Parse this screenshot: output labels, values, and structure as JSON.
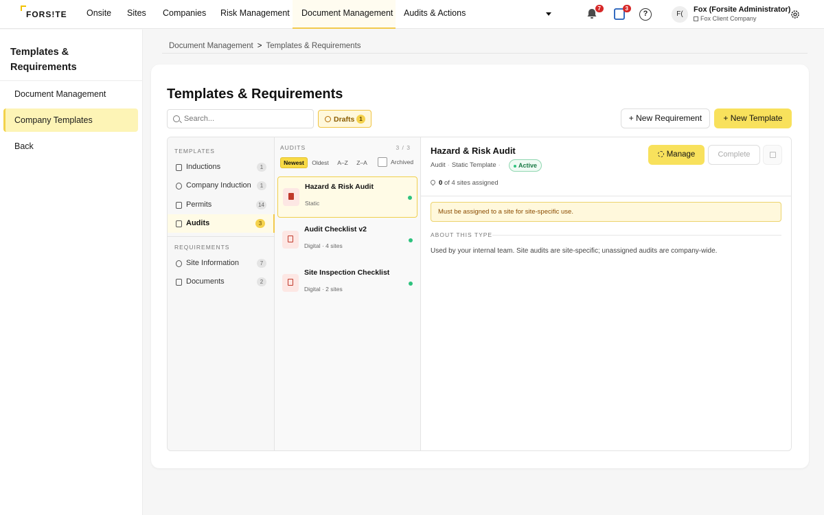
{
  "nav": {
    "logo": "FORS!TE",
    "items": [
      "Onsite",
      "Sites",
      "Companies",
      "Risk Management",
      "Document Management",
      "Audits & Actions"
    ],
    "active_index": 4,
    "notifications_count": "7",
    "tasks_count": "3",
    "help_label": "?",
    "user_initials": "F(",
    "user_name": "Fox (Forsite Administrator)",
    "user_company": "Fox Client Company"
  },
  "sidebar": {
    "title": "Templates & Requirements",
    "items": [
      {
        "label": "Document Management",
        "active": false
      },
      {
        "label": "Company Templates",
        "active": true
      },
      {
        "label": "Back",
        "active": false
      }
    ]
  },
  "breadcrumb": {
    "parent": "Document Management",
    "separator": ">",
    "current": "Templates & Requirements"
  },
  "main": {
    "title": "Templates & Requirements",
    "search_placeholder": "Search...",
    "drafts_label": "Drafts",
    "drafts_count": "1",
    "new_requirement_label": "+ New Requirement",
    "new_template_label": "+ New Template"
  },
  "categories": {
    "templates_label": "TEMPLATES",
    "templates": [
      {
        "label": "Inductions",
        "count": "1",
        "icon": "clipboard-icon",
        "active": false
      },
      {
        "label": "Company Induction",
        "count": "1",
        "icon": "users-icon",
        "active": false
      },
      {
        "label": "Permits",
        "count": "14",
        "icon": "file-icon",
        "active": false
      },
      {
        "label": "Audits",
        "count": "3",
        "icon": "checkbox-icon",
        "active": true
      }
    ],
    "requirements_label": "REQUIREMENTS",
    "requirements": [
      {
        "label": "Site Information",
        "count": "7",
        "icon": "info-icon"
      },
      {
        "label": "Documents",
        "count": "2",
        "icon": "folder-icon"
      }
    ]
  },
  "audits": {
    "label": "AUDITS",
    "count": "3 / 3",
    "sort_options": [
      "Newest",
      "Oldest",
      "A–Z",
      "Z–A"
    ],
    "active_sort": "Newest",
    "archived_label": "Archived",
    "items": [
      {
        "title": "Hazard & Risk Audit",
        "subtitle": "Static",
        "active": true,
        "status_color": "#2ec27e"
      },
      {
        "title": "Audit Checklist v2",
        "subtitle": "Digital · 4 sites",
        "active": false,
        "status_color": "#2ec27e"
      },
      {
        "title": "Site Inspection Checklist",
        "subtitle": "Digital · 2 sites",
        "active": false,
        "status_color": "#2ec27e"
      }
    ]
  },
  "detail": {
    "title": "Hazard & Risk Audit",
    "type": "Audit",
    "template_kind": "Static Template",
    "status": "Active",
    "assigned_count": "0",
    "assigned_text": "of 4 sites assigned",
    "manage_label": "Manage",
    "complete_label": "Complete",
    "warning": "Must be assigned to a site for site-specific use.",
    "about_label": "ABOUT THIS TYPE",
    "about_text": "Used by your internal team. Site audits are site-specific; unassigned audits are company-wide."
  },
  "colors": {
    "accent": "#f8e15c",
    "active_green": "#2ec27e",
    "badge_red": "#d62828"
  }
}
